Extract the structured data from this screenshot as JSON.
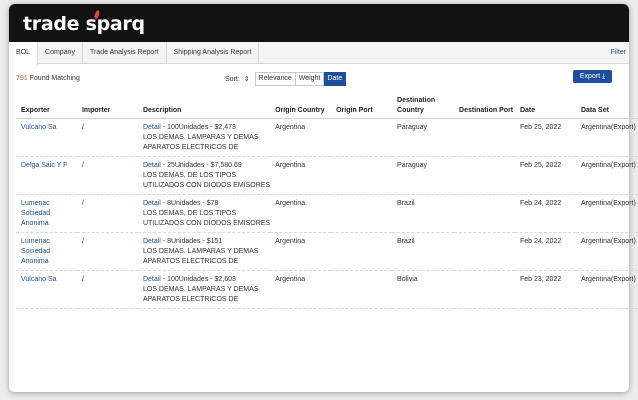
{
  "app": {
    "logo_text": "trade sparq"
  },
  "tabs": [
    "BOL",
    "Company",
    "Trade Analysis Report",
    "Shipping Analysis Report"
  ],
  "filter_label": "Filter",
  "results": {
    "count": "791",
    "label": "Found Matching"
  },
  "sort": {
    "label": "Sort:",
    "options": [
      "Relevance",
      "Weight",
      "Date"
    ],
    "active": "Date"
  },
  "export_label": "Export",
  "table": {
    "headers": [
      "Exporter",
      "Importer",
      "Description",
      "Origin Country",
      "Origin Port",
      "Destination Country",
      "Destination Port",
      "Date",
      "Data Set"
    ],
    "rows": [
      {
        "exporter": "Vulcano Sa",
        "importer": "/",
        "detail": "Detail",
        "summary": " - 100Unidades - $2,473",
        "desc1": "LOS DEMAS. LAMPARAS Y DEMAS",
        "desc2": "APARATOS ELECTRICOS DE",
        "origin_country": "Argentina",
        "origin_port": "",
        "destination_country": "Paraguay",
        "destination_port": "",
        "date": "Feb 25, 2022",
        "dataset": "Argentina(Export)"
      },
      {
        "exporter": "Delga Saic Y F",
        "importer": "/",
        "detail": "Detail",
        "summary": " - 25Unidades - $7,580.69",
        "desc1": "LOS DEMAS, DE LOS TIPOS",
        "desc2": "UTILIZADOS CON DIODOS EMISORES",
        "origin_country": "Argentina",
        "origin_port": "",
        "destination_country": "Paraguay",
        "destination_port": "",
        "date": "Feb 25, 2022",
        "dataset": "Argentina(Export)"
      },
      {
        "exporter": "Lumenac Sociedad Anonima",
        "importer": "/",
        "detail": "Detail",
        "summary": " - 8Unidades - $78",
        "desc1": "LOS DEMAS, DE LOS TIPOS",
        "desc2": "UTILIZADOS CON DIODOS EMISORES",
        "origin_country": "Argentina",
        "origin_port": "",
        "destination_country": "Brazil",
        "destination_port": "",
        "date": "Feb 24, 2022",
        "dataset": "Argentina(Export)"
      },
      {
        "exporter": "Lumenac Sociedad Anonima",
        "importer": "/",
        "detail": "Detail",
        "summary": " - 8Unidades - $151",
        "desc1": "LOS DEMAS. LAMPARAS Y DEMAS",
        "desc2": "APARATOS ELECTRICOS DE",
        "origin_country": "Argentina",
        "origin_port": "",
        "destination_country": "Brazil",
        "destination_port": "",
        "date": "Feb 24, 2022",
        "dataset": "Argentina(Export)"
      },
      {
        "exporter": "Vulcano Sa",
        "importer": "/",
        "detail": "Detail",
        "summary": " - 100Unidades - $2,603",
        "desc1": "LOS DEMAS. LAMPARAS Y DEMAS",
        "desc2": "APARATOS ELECTRICOS DE",
        "origin_country": "Argentina",
        "origin_port": "",
        "destination_country": "Bolivia",
        "destination_port": "",
        "date": "Feb 23, 2022",
        "dataset": "Argentina(Export)"
      }
    ]
  },
  "colors": {
    "topbar": "#121212",
    "accent": "#1f4f9c",
    "link": "#1f4f8f",
    "flame": "#e0442a"
  }
}
